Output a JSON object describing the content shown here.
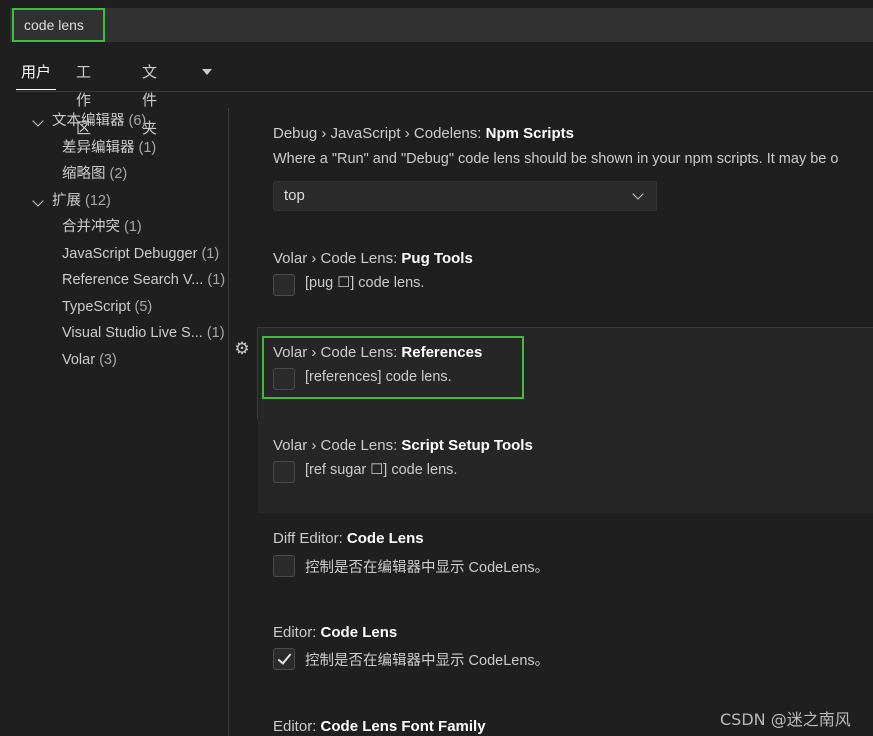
{
  "search": {
    "value": "code lens"
  },
  "tabs": [
    {
      "label": "用户",
      "active": true
    },
    {
      "label": "工作区"
    },
    {
      "label": "文件夹"
    }
  ],
  "tree": [
    {
      "label": "文本编辑器",
      "count": "(6)",
      "expanded": true
    },
    {
      "label": "差异编辑器",
      "count": "(1)"
    },
    {
      "label": "缩略图",
      "count": "(2)"
    },
    {
      "label": "扩展",
      "count": "(12)",
      "expanded": true
    },
    {
      "label": "合并冲突",
      "count": "(1)"
    },
    {
      "label": "JavaScript Debugger",
      "count": "(1)"
    },
    {
      "label": "Reference Search V...",
      "count": "(1)"
    },
    {
      "label": "TypeScript",
      "count": "(5)"
    },
    {
      "label": "Visual Studio Live S...",
      "count": "(1)"
    },
    {
      "label": "Volar",
      "count": "(3)"
    }
  ],
  "settings": {
    "npm": {
      "prefix": "Debug › JavaScript › Codelens: ",
      "name": "Npm Scripts",
      "desc": "Where a \"Run\" and \"Debug\" code lens should be shown in your npm scripts. It may be o",
      "value": "top"
    },
    "pug": {
      "prefix": "Volar › Code Lens: ",
      "name": "Pug Tools",
      "label": "[pug ☐] code lens.",
      "checked": false
    },
    "references": {
      "prefix": "Volar › Code Lens: ",
      "name": "References",
      "label": "[references] code lens.",
      "checked": false
    },
    "script_setup": {
      "prefix": "Volar › Code Lens: ",
      "name": "Script Setup Tools",
      "label": "[ref sugar ☐] code lens.",
      "checked": false
    },
    "diff": {
      "prefix": "Diff Editor: ",
      "name": "Code Lens",
      "label": "控制是否在编辑器中显示 CodeLens。",
      "checked": false
    },
    "editor": {
      "prefix": "Editor: ",
      "name": "Code Lens",
      "label": "控制是否在编辑器中显示 CodeLens。",
      "checked": true
    },
    "font": {
      "prefix": "Editor: ",
      "name": "Code Lens Font Family"
    }
  },
  "gear_icon": "gear-icon",
  "watermark": "CSDN @迷之南风",
  "colors": {
    "highlight": "#3cbd3c",
    "background": "#1f1f1f"
  }
}
